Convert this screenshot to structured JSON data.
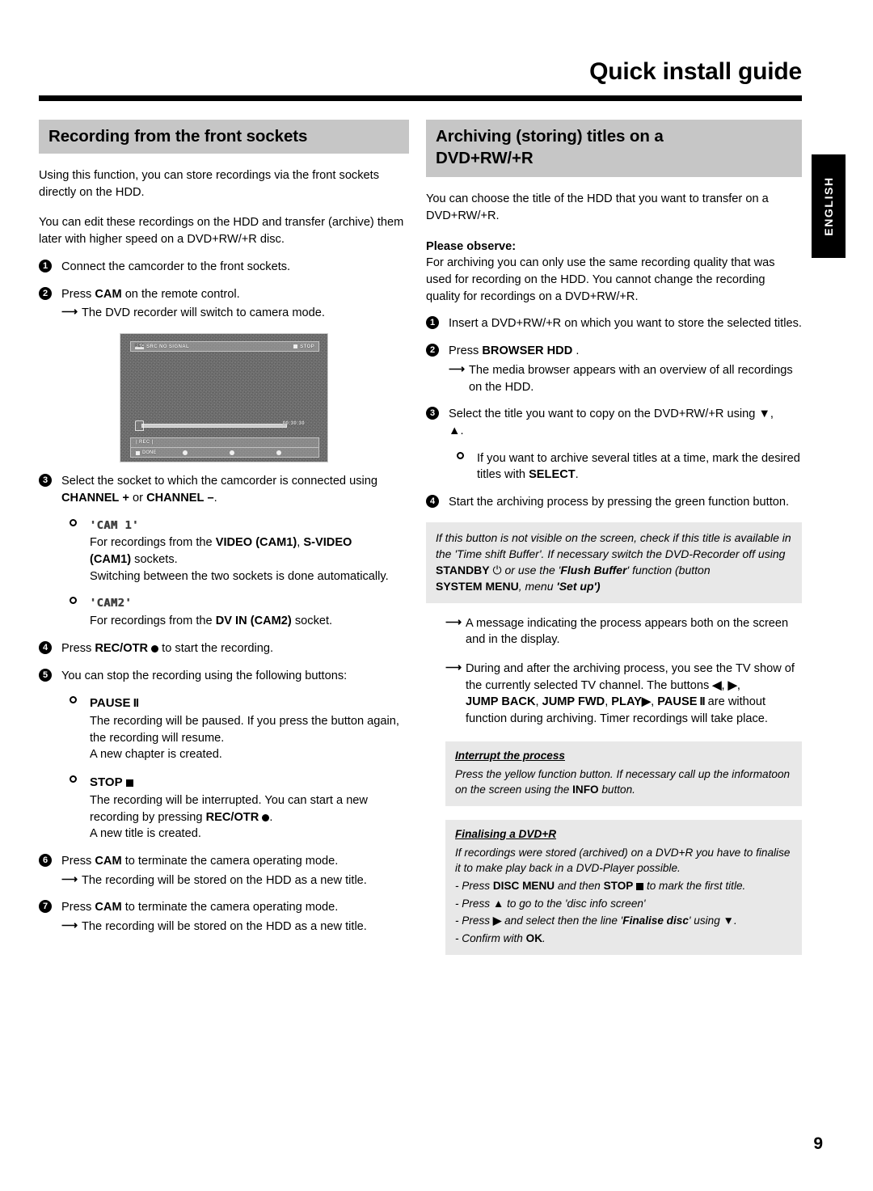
{
  "header": {
    "title": "Quick install guide"
  },
  "lang_tab": {
    "label": "ENGLISH"
  },
  "page_number": "9",
  "left_column": {
    "heading": "Recording from the front sockets",
    "intro1": "Using this function, you can store recordings via the front sockets directly on the HDD.",
    "intro2": "You can edit these recordings on the HDD and transfer (archive) them later with higher speed on a DVD+RW/+R disc.",
    "steps": {
      "s1_num": "1",
      "s1_text": "Connect the camcorder to the front sockets.",
      "s2_num": "2",
      "s2_press": "Press",
      "s2_key": "CAM",
      "s2_rest": "on the remote control.",
      "s2_arrow": "The DVD recorder will switch to camera mode.",
      "s3_num": "3",
      "s3_text": "Select the socket to which the camcorder is connected using",
      "s3_key1": "CHANNEL",
      "s3_plus": "+",
      "s3_or": "or",
      "s3_key2": "CHANNEL",
      "s3_minus": "–",
      "s3_period": ".",
      "cam1_label": "'CAM 1'",
      "cam1_line1_pre": "For recordings from the",
      "cam1_key1": "VIDEO (CAM1)",
      "cam1_comma": ",",
      "cam1_key2": "S-VIDEO",
      "cam1_key3": "(CAM1)",
      "cam1_line2_post": "sockets.",
      "cam1_line3": "Switching between the two sockets is done automatically.",
      "cam2_label": "'CAM2'",
      "cam2_line_pre": "For recordings from the",
      "cam2_key": "DV IN (CAM2)",
      "cam2_line_post": "socket.",
      "s4_num": "4",
      "s4_press": "Press",
      "s4_key": "REC/OTR",
      "s4_rest": "to start the recording.",
      "s5_num": "5",
      "s5_text": "You can stop the recording using the following buttons:",
      "pause_title": "PAUSE",
      "pause_body1": "The recording will be paused. If you press the button again, the recording will resume.",
      "pause_body2": "A new chapter is created.",
      "stop_title": "STOP",
      "stop_body1_pre": "The recording will be interrupted. You can start a new recording by pressing",
      "stop_body1_key": "REC/OTR",
      "stop_body1_post": ".",
      "stop_body2": "A new title is created.",
      "s6_num": "6",
      "s6_press": "Press",
      "s6_key": "CAM",
      "s6_rest": "to terminate the camera operating mode.",
      "s6_arrow": "The recording will be stored on the HDD as a new title.",
      "s7_num": "7",
      "s7_press": "Press",
      "s7_key": "CAM",
      "s7_rest": "to terminate the camera operating mode.",
      "s7_arrow": "The recording will be stored on the HDD as a new title."
    },
    "tv_screenshot": {
      "source_label": "SRC NO SIGNAL",
      "rec_badge": "REC",
      "status_label": "STOP",
      "progress_time": "00:30:30",
      "bottom_row1": "| REC |",
      "fn_button_1": "DONE"
    }
  },
  "right_column": {
    "heading_line1": "Archiving (storing) titles on a",
    "heading_line2": "DVD+RW/+R",
    "intro": "You can choose the title of the HDD that you want to transfer on a DVD+RW/+R.",
    "observe_title": "Please observe:",
    "observe_body": "For archiving you can only use the same recording quality that was used for recording on the HDD. You cannot change the recording quality for recordings on a DVD+RW/+R.",
    "steps": {
      "r1_num": "1",
      "r1_text": "Insert a DVD+RW/+R on which you want to store the selected titles.",
      "r2_num": "2",
      "r2_press": "Press",
      "r2_key": "BROWSER HDD",
      "r2_period": ".",
      "r2_arrow": "The media browser appears with an overview of all recordings on the HDD.",
      "r3_num": "3",
      "r3_text": "Select the title you want to copy on the DVD+RW/+R using",
      "r3_down": "▼",
      "r3_comma": ",",
      "r3_up": "▲",
      "r3_period": ".",
      "r3_bullet_pre": "If you want to archive several titles at a time, mark the desired titles with",
      "r3_bullet_key": "SELECT",
      "r3_bullet_post": ".",
      "r4_num": "4",
      "r4_text": "Start the archiving process by pressing the green function button."
    },
    "notebox1": {
      "line1": "If this button is not visible on the screen, check if this title is available in the 'Time shift Buffer'. If necessary switch the DVD-Recorder off using",
      "key1": "STANDBY",
      "standby_icon": "⏻",
      "mid": "or use the '",
      "flush": "Flush Buffer",
      "after_flush": "' function (button",
      "key2": "SYSTEM MENU",
      "comma": ",",
      "menu_word": "menu",
      "setup": "'Set up')"
    },
    "arrow1": "A message indicating the process appears both on the screen and in the display.",
    "arrow2_pre": "During and after the archiving process, you see the TV show of the currently selected TV channel. The buttons",
    "arrow2_left": "◀",
    "arrow2_right": "▶",
    "arrow2_keys": {
      "jump_back": "JUMP BACK",
      "jump_fwd": "JUMP FWD",
      "play": "PLAY",
      "play_icon": "▶",
      "pause": "PAUSE"
    },
    "arrow2_post": "are without function during archiving. Timer recordings will take place.",
    "notebox2": {
      "title": "Interrupt the process",
      "body_pre": "Press the yellow function button. If necessary call up the informatoon on the screen using the",
      "key": "INFO",
      "body_post": "button."
    },
    "notebox3": {
      "title": "Finalising a DVD+R",
      "body": "If recordings were stored (archived) on a DVD+R you have to finalise it to make play back in a DVD-Player possible.",
      "d1_press": "- Press",
      "d1_key1": "DISC MENU",
      "d1_and": "and then",
      "d1_key2": "STOP",
      "d1_post": "to mark the first title.",
      "d2_press": "- Press",
      "d2_icon": "▲",
      "d2_post": "to go to the 'disc info screen'",
      "d3_press": "- Press",
      "d3_icon": "▶",
      "d3_mid": "and select then the line '",
      "d3_bold": "Finalise disc",
      "d3_using": "' using",
      "d3_icon2": "▼",
      "d3_period": ".",
      "d4_press": "- Confirm with",
      "d4_key": "OK",
      "d4_period": "."
    }
  }
}
